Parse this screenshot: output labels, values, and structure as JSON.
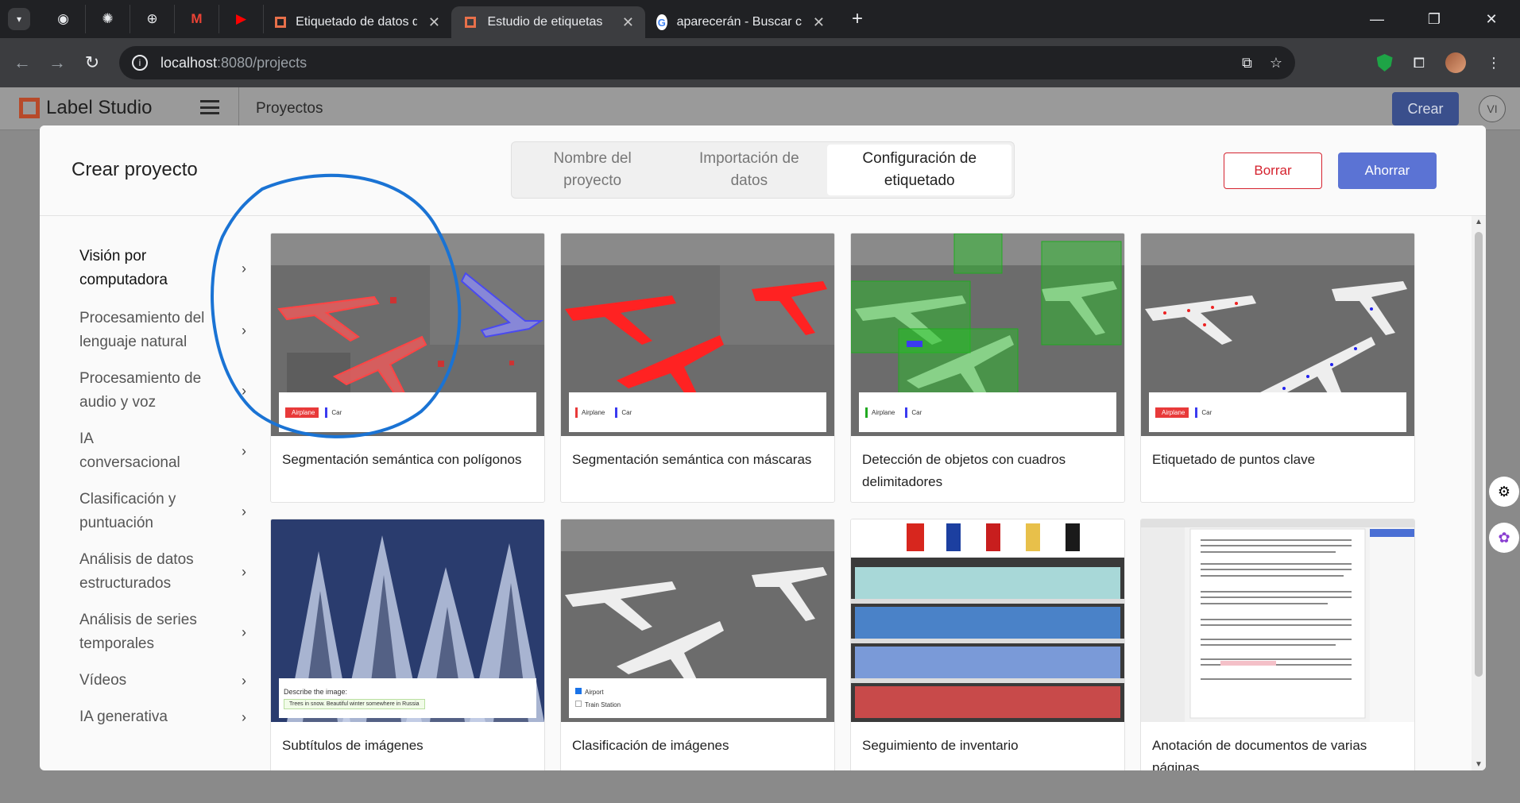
{
  "browser": {
    "tabs": [
      {
        "title": "Etiquetado de datos de código",
        "active": false
      },
      {
        "title": "Estudio de etiquetas",
        "active": true
      },
      {
        "title": "aparecerán - Buscar con Google",
        "active": false
      }
    ],
    "url_host": "localhost",
    "url_path": ":8080/projects"
  },
  "app": {
    "logo_text": "Label Studio",
    "breadcrumb": "Proyectos",
    "create_label": "Crear",
    "user_initials": "VI"
  },
  "modal": {
    "title": "Crear proyecto",
    "steps": [
      {
        "label": "Nombre del proyecto",
        "active": false
      },
      {
        "label": "Importación de datos",
        "active": false
      },
      {
        "label": "Configuración de etiquetado",
        "active": true
      }
    ],
    "delete_label": "Borrar",
    "save_label": "Ahorrar",
    "categories": [
      {
        "label": "Visión por computadora",
        "active": true
      },
      {
        "label": "Procesamiento del lenguaje natural",
        "active": false
      },
      {
        "label": "Procesamiento de audio y voz",
        "active": false
      },
      {
        "label": "IA conversacional",
        "active": false
      },
      {
        "label": "Clasificación y puntuación",
        "active": false
      },
      {
        "label": "Análisis de datos estructurados",
        "active": false
      },
      {
        "label": "Análisis de series temporales",
        "active": false
      },
      {
        "label": "Vídeos",
        "active": false
      },
      {
        "label": "IA generativa",
        "active": false
      }
    ],
    "templates": [
      {
        "title": "Segmentación semántica con polígonos",
        "chips": [
          "Airplane",
          "Car"
        ]
      },
      {
        "title": "Segmentación semántica con máscaras",
        "chips": [
          "Airplane",
          "Car"
        ]
      },
      {
        "title": "Detección de objetos con cuadros delimitadores",
        "chips": [
          "Airplane",
          "Car"
        ]
      },
      {
        "title": "Etiquetado de puntos clave",
        "chips": [
          "Airplane",
          "Car"
        ]
      },
      {
        "title": "Subtítulos de imágenes",
        "caption_prompt": "Describe the image:",
        "caption_value": "Trees in snow. Beautiful winter somewhere in Russia"
      },
      {
        "title": "Clasificación de imágenes",
        "options": [
          "Airport",
          "Train Station"
        ]
      },
      {
        "title": "Seguimiento de inventario"
      },
      {
        "title": "Anotación de documentos de varias páginas"
      }
    ]
  },
  "colors": {
    "accent": "#5b73d4",
    "danger": "#d5232f",
    "annotation_circle": "#1a73d4"
  }
}
